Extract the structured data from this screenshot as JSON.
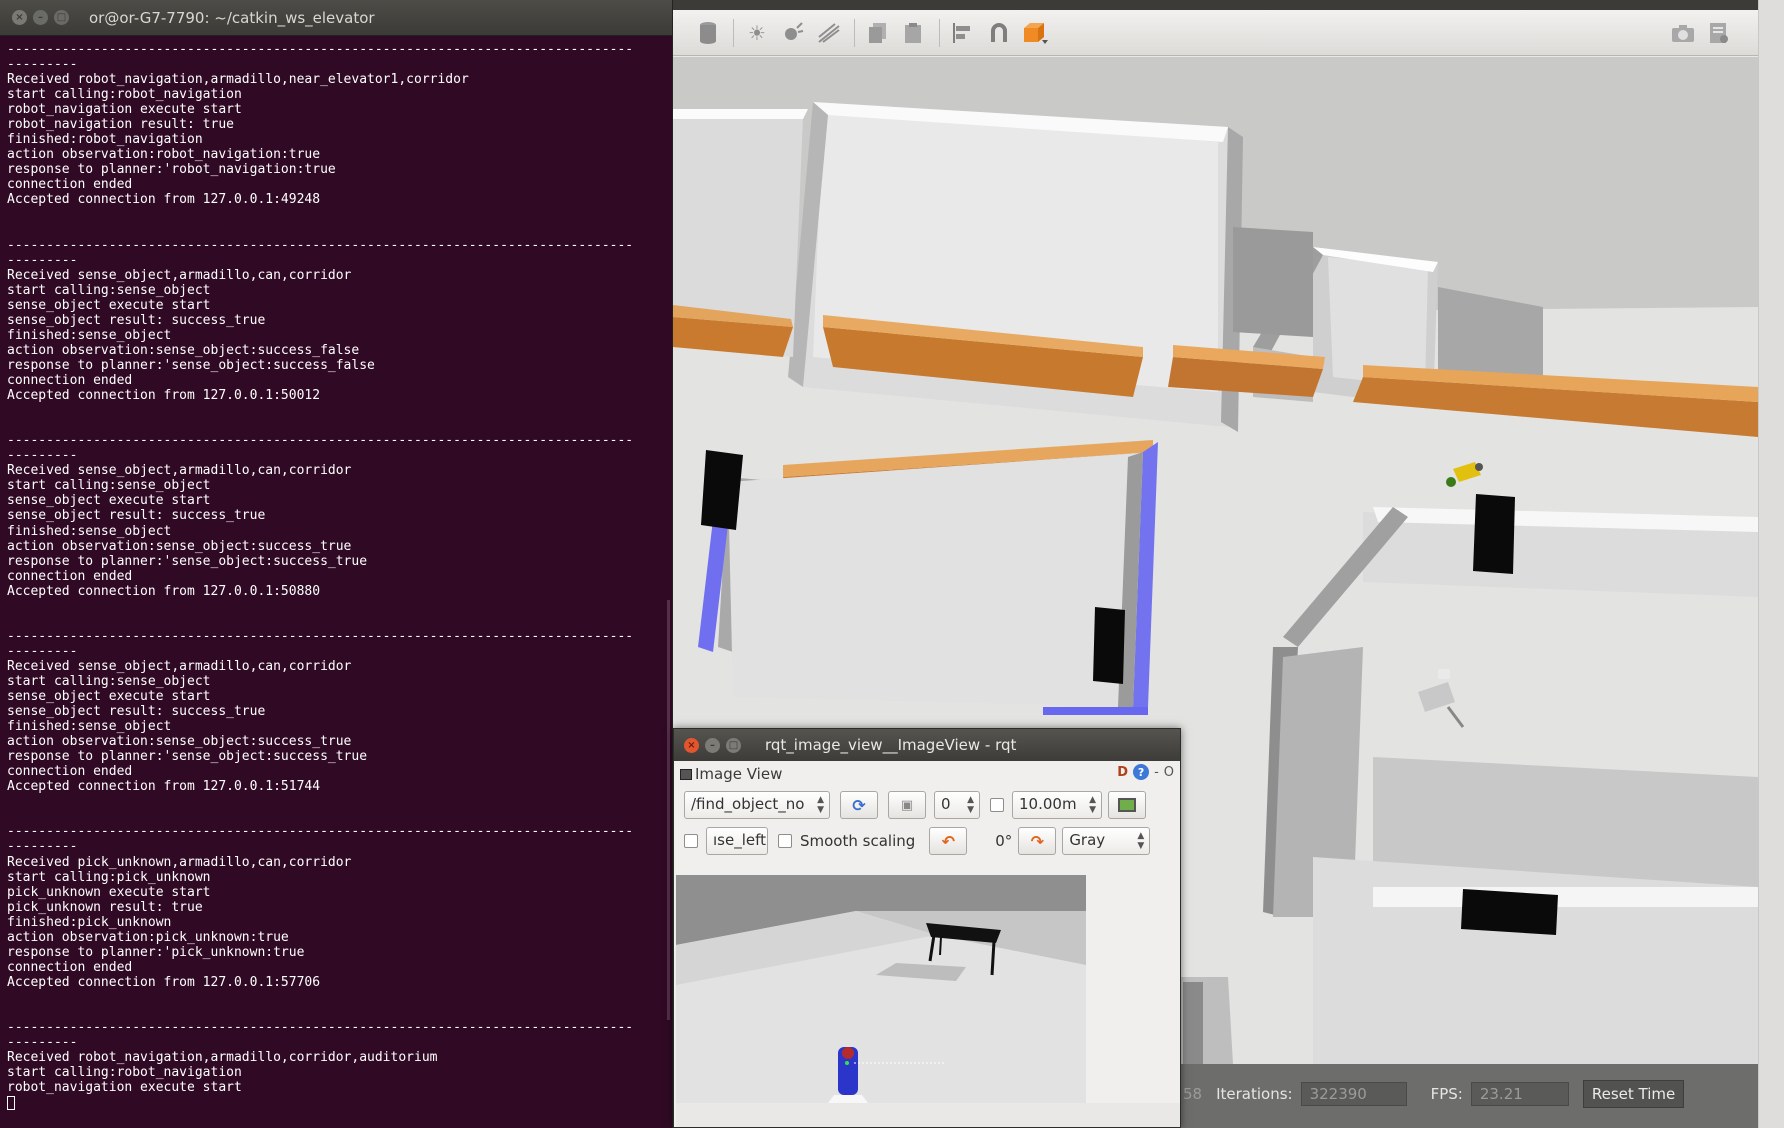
{
  "terminal": {
    "title": "or@or-G7-7790: ~/catkin_ws_elevator",
    "lines": [
      "--------------------------------------------------------------------------------",
      "---------",
      "Received robot_navigation,armadillo,near_elevator1,corridor",
      "start calling:robot_navigation",
      "robot_navigation execute start",
      "robot_navigation result: true",
      "finished:robot_navigation",
      "action observation:robot_navigation:true",
      "response to planner:'robot_navigation:true",
      "connection ended",
      "Accepted connection from 127.0.0.1:49248",
      "",
      "",
      "--------------------------------------------------------------------------------",
      "---------",
      "Received sense_object,armadillo,can,corridor",
      "start calling:sense_object",
      "sense_object execute start",
      "sense_object result: success_true",
      "finished:sense_object",
      "action observation:sense_object:success_false",
      "response to planner:'sense_object:success_false",
      "connection ended",
      "Accepted connection from 127.0.0.1:50012",
      "",
      "",
      "--------------------------------------------------------------------------------",
      "---------",
      "Received sense_object,armadillo,can,corridor",
      "start calling:sense_object",
      "sense_object execute start",
      "sense_object result: success_true",
      "finished:sense_object",
      "action observation:sense_object:success_true",
      "response to planner:'sense_object:success_true",
      "connection ended",
      "Accepted connection from 127.0.0.1:50880",
      "",
      "",
      "--------------------------------------------------------------------------------",
      "---------",
      "Received sense_object,armadillo,can,corridor",
      "start calling:sense_object",
      "sense_object execute start",
      "sense_object result: success_true",
      "finished:sense_object",
      "action observation:sense_object:success_true",
      "response to planner:'sense_object:success_true",
      "connection ended",
      "Accepted connection from 127.0.0.1:51744",
      "",
      "",
      "--------------------------------------------------------------------------------",
      "---------",
      "Received pick_unknown,armadillo,can,corridor",
      "start calling:pick_unknown",
      "pick_unknown execute start",
      "pick_unknown result: true",
      "finished:pick_unknown",
      "action observation:pick_unknown:true",
      "response to planner:'pick_unknown:true",
      "connection ended",
      "Accepted connection from 127.0.0.1:57706",
      "",
      "",
      "--------------------------------------------------------------------------------",
      "---------",
      "Received robot_navigation,armadillo,corridor,auditorium",
      "start calling:robot_navigation",
      "robot_navigation execute start"
    ]
  },
  "gazebo": {
    "status": {
      "sim_time_fragment": "58",
      "iterations_label": "Iterations:",
      "iterations_value": "322390",
      "fps_label": "FPS:",
      "fps_value": "23.21",
      "reset_time_label": "Reset Time"
    }
  },
  "rqt": {
    "title": "rqt_image_view__ImageView - rqt",
    "plugin_label": "Image View",
    "plugin_d": "D",
    "plugin_help": "?",
    "plugin_dash": "-",
    "plugin_o": "O",
    "topic_value": "/find_object_no",
    "spin_value": "0",
    "distance_value": "10.00m",
    "topic_suffix_value": "ıse_left",
    "smooth_scaling_label": "Smooth scaling",
    "rotation_value": "0°",
    "color_mode_value": "Gray"
  },
  "colors": {
    "terminal_bg": "#300a24",
    "terminal_text": "#ffffff",
    "rqt_close": "#e3552e",
    "accent_blue": "#3c78d8"
  }
}
